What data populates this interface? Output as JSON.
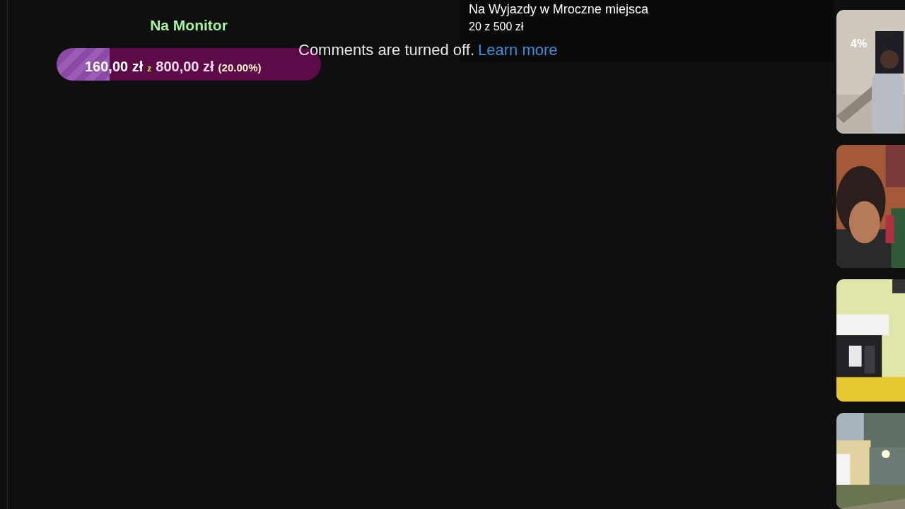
{
  "goal_widget": {
    "title": "Na Monitor",
    "raised": "160,00 zł",
    "separator": "z",
    "target": "800,00 zł",
    "percent": "(20.00%)",
    "level": 0.2
  },
  "comments": {
    "message": "Comments are turned off.",
    "link": "Learn more"
  },
  "goal_overlay": {
    "title": "Na Wyjazdy w Mroczne miejsca",
    "progress": "20 z 500 zł"
  },
  "thumbnails": [
    {
      "kind": "picture",
      "badge": "4%"
    },
    {
      "kind": "picture"
    },
    {
      "kind": "picture"
    },
    {
      "kind": "picture"
    }
  ]
}
